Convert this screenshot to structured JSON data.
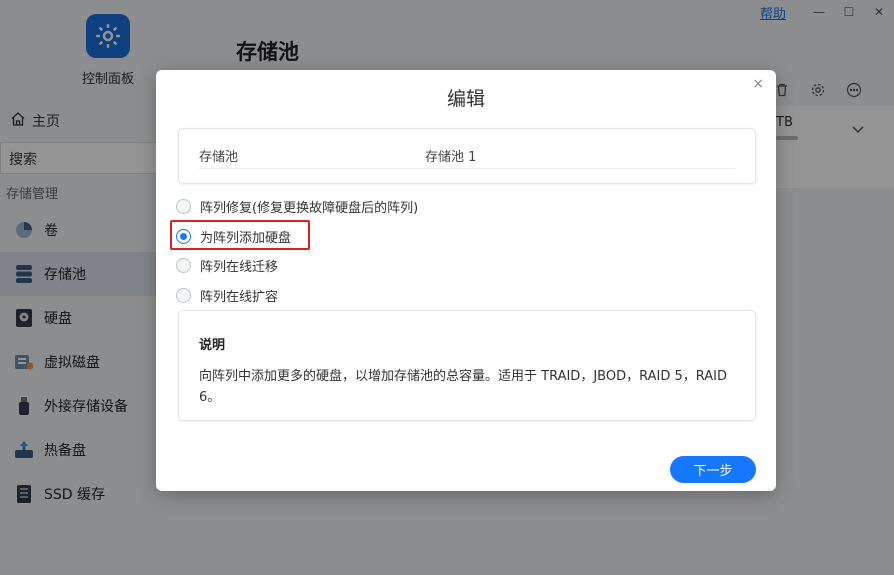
{
  "window": {
    "help_link": "帮助",
    "minimize_glyph": "—",
    "maximize_glyph": "☐",
    "close_glyph": "✕"
  },
  "app": {
    "name": "控制面板",
    "page_title": "存储池"
  },
  "sidebar": {
    "home_label": "主页",
    "search_placeholder": "搜索",
    "section_label": "存储管理",
    "items": [
      {
        "label": "卷",
        "icon": "volume-icon"
      },
      {
        "label": "存储池",
        "icon": "storage-pool-icon"
      },
      {
        "label": "硬盘",
        "icon": "disk-icon"
      },
      {
        "label": "虚拟磁盘",
        "icon": "virtual-disk-icon"
      },
      {
        "label": "外接存储设备",
        "icon": "external-storage-icon"
      },
      {
        "label": "热备盘",
        "icon": "hot-spare-icon"
      },
      {
        "label": "SSD 缓存",
        "icon": "ssd-cache-icon"
      }
    ]
  },
  "pool_card": {
    "capacity_unit": "TB"
  },
  "modal": {
    "title": "编辑",
    "close_glyph": "×",
    "info_label": "存储池",
    "info_value": "存储池 1",
    "options": [
      {
        "label": "阵列修复(修复更换故障硬盘后的阵列)",
        "checked": false
      },
      {
        "label": "为阵列添加硬盘",
        "checked": true
      },
      {
        "label": "阵列在线迁移",
        "checked": false
      },
      {
        "label": "阵列在线扩容",
        "checked": false
      }
    ],
    "description_title": "说明",
    "description_text": "向阵列中添加更多的硬盘，以增加存储池的总容量。适用于 TRAID，JBOD，RAID 5，RAID 6。",
    "next_button": "下一步"
  },
  "colors": {
    "accent": "#1677ff",
    "highlight": "#e02020",
    "overlay": "rgba(0,0,0,0.42)"
  }
}
